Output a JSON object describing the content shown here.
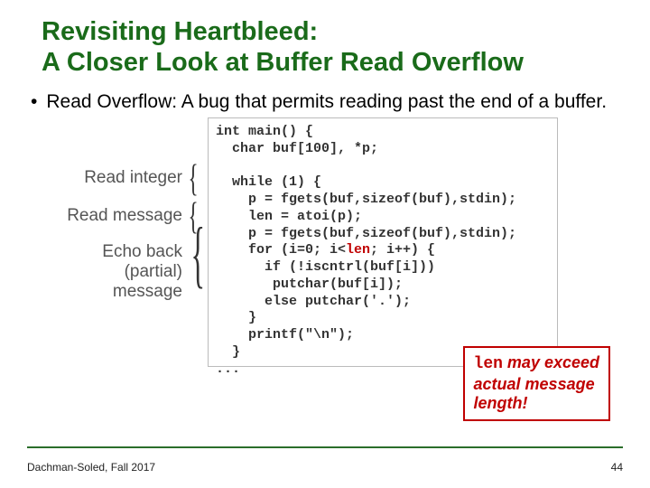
{
  "title_line1": "Revisiting Heartbleed:",
  "title_line2": "A Closer Look at Buffer Read Overflow",
  "bullet": "Read Overflow: A bug that permits reading past the end of a buffer.",
  "labels": {
    "read_int": "Read integer",
    "read_msg": "Read message",
    "echo_l1": "Echo back",
    "echo_l2": "(partial)",
    "echo_l3": "message"
  },
  "code": {
    "l1": "int main() {",
    "l2": "  char buf[100], *p;",
    "l3": "",
    "l4": "  while (1) {",
    "l5": "    p = fgets(buf,sizeof(buf),stdin);",
    "l6": "    len = atoi(p);",
    "l7": "    p = fgets(buf,sizeof(buf),stdin);",
    "l8a": "    for (i=0; i<",
    "l8b": "len",
    "l8c": "; i++) {",
    "l9": "      if (!iscntrl(buf[i]))",
    "l10": "       putchar(buf[i]);",
    "l11": "      else putchar('.');",
    "l12": "    }",
    "l13": "    printf(\"\\n\");",
    "l14": "  }",
    "l15": "..."
  },
  "callout": {
    "mono": "len",
    "rest1": " may exceed",
    "rest2": "actual message",
    "rest3": "length!"
  },
  "footer": {
    "left": "Dachman-Soled, Fall 2017",
    "right": "44"
  }
}
